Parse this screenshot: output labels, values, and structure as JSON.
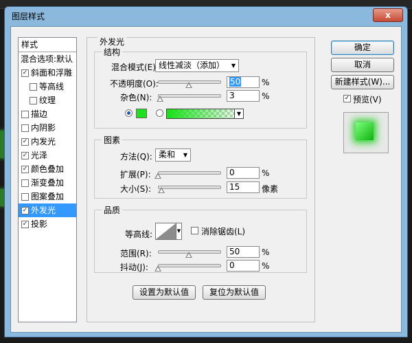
{
  "window": {
    "title": "图层样式",
    "close_glyph": "x"
  },
  "styles_header": "样式",
  "styles": [
    {
      "label": "混合选项:默认",
      "checkbox": false,
      "checked": false,
      "indent": false,
      "selected": false
    },
    {
      "label": "斜面和浮雕",
      "checkbox": true,
      "checked": true,
      "indent": false,
      "selected": false
    },
    {
      "label": "等高线",
      "checkbox": true,
      "checked": false,
      "indent": true,
      "selected": false
    },
    {
      "label": "纹理",
      "checkbox": true,
      "checked": false,
      "indent": true,
      "selected": false
    },
    {
      "label": "描边",
      "checkbox": true,
      "checked": false,
      "indent": false,
      "selected": false
    },
    {
      "label": "内阴影",
      "checkbox": true,
      "checked": false,
      "indent": false,
      "selected": false
    },
    {
      "label": "内发光",
      "checkbox": true,
      "checked": true,
      "indent": false,
      "selected": false
    },
    {
      "label": "光泽",
      "checkbox": true,
      "checked": true,
      "indent": false,
      "selected": false
    },
    {
      "label": "颜色叠加",
      "checkbox": true,
      "checked": true,
      "indent": false,
      "selected": false
    },
    {
      "label": "渐变叠加",
      "checkbox": true,
      "checked": false,
      "indent": false,
      "selected": false
    },
    {
      "label": "图案叠加",
      "checkbox": true,
      "checked": false,
      "indent": false,
      "selected": false
    },
    {
      "label": "外发光",
      "checkbox": true,
      "checked": true,
      "indent": false,
      "selected": true
    },
    {
      "label": "投影",
      "checkbox": true,
      "checked": true,
      "indent": false,
      "selected": false
    }
  ],
  "panel": {
    "title": "外发光",
    "structure": {
      "label": "结构",
      "blend_mode_label": "混合模式(E):",
      "blend_mode_value": "线性减淡（添加）",
      "opacity_label": "不透明度(O):",
      "opacity_value": "50",
      "opacity_level": 0.5,
      "noise_label": "杂色(N):",
      "noise_value": "3",
      "noise_level": 0.03,
      "unit": "%",
      "color": "#1fe01f"
    },
    "elements": {
      "label": "图素",
      "method_label": "方法(Q):",
      "method_value": "柔和",
      "spread_label": "扩展(P):",
      "spread_value": "0",
      "spread_level": 0,
      "size_label": "大小(S):",
      "size_value": "15",
      "size_level": 0.06,
      "size_unit": "像素",
      "unit": "%"
    },
    "quality": {
      "label": "品质",
      "contour_label": "等高线:",
      "antialias_label": "消除锯齿(L)",
      "range_label": "范围(R):",
      "range_value": "50",
      "range_level": 0.5,
      "jitter_label": "抖动(J):",
      "jitter_value": "0",
      "jitter_level": 0,
      "unit": "%"
    },
    "make_default": "设置为默认值",
    "reset_default": "复位为默认值"
  },
  "buttons": {
    "ok": "确定",
    "cancel": "取消",
    "new_style": "新建样式(W)...",
    "preview": "预览(V)",
    "preview_checked": true
  },
  "colors": {
    "selection": "#3399ff",
    "glow": "#1fe01f"
  }
}
